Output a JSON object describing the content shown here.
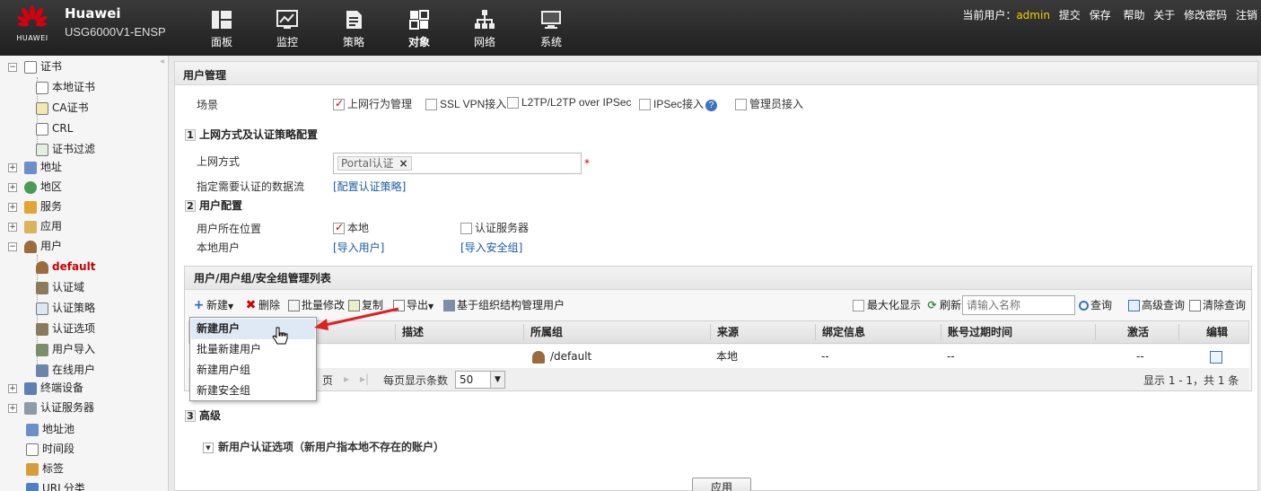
{
  "topbar": {
    "logo_text": "HUAWEI",
    "brand_name": "Huawei",
    "product": "USG6000V1-ENSP",
    "nav": [
      {
        "label": "面板",
        "icon": "dashboard-icon"
      },
      {
        "label": "监控",
        "icon": "monitor-icon"
      },
      {
        "label": "策略",
        "icon": "policy-icon"
      },
      {
        "label": "对象",
        "icon": "object-icon"
      },
      {
        "label": "网络",
        "icon": "network-icon"
      },
      {
        "label": "系统",
        "icon": "system-icon"
      }
    ],
    "current_user_label": "当前用户：",
    "current_user": "admin",
    "links": [
      "提交",
      "保存",
      "帮助",
      "关于",
      "修改密码",
      "注销"
    ]
  },
  "sidebar": {
    "collapse_glyph": "«",
    "items": [
      {
        "label": "证书",
        "level": 0,
        "expander": "−"
      },
      {
        "label": "本地证书",
        "level": 1
      },
      {
        "label": "CA证书",
        "level": 1
      },
      {
        "label": "CRL",
        "level": 1
      },
      {
        "label": "证书过滤",
        "level": 1
      },
      {
        "label": "地址",
        "level": 0,
        "expander": "+"
      },
      {
        "label": "地区",
        "level": 0,
        "expander": "+"
      },
      {
        "label": "服务",
        "level": 0,
        "expander": "+"
      },
      {
        "label": "应用",
        "level": 0,
        "expander": "+"
      },
      {
        "label": "用户",
        "level": 0,
        "expander": "−"
      },
      {
        "label": "default",
        "level": 1,
        "selected": true
      },
      {
        "label": "认证域",
        "level": 1
      },
      {
        "label": "认证策略",
        "level": 1
      },
      {
        "label": "认证选项",
        "level": 1
      },
      {
        "label": "用户导入",
        "level": 1
      },
      {
        "label": "在线用户",
        "level": 1
      },
      {
        "label": "终端设备",
        "level": 0,
        "expander": "+"
      },
      {
        "label": "认证服务器",
        "level": 0,
        "expander": "+"
      },
      {
        "label": "地址池",
        "level": 0
      },
      {
        "label": "时间段",
        "level": 0
      },
      {
        "label": "标签",
        "level": 0
      },
      {
        "label": "URL分类",
        "level": 0
      }
    ]
  },
  "main": {
    "page_title": "用户管理",
    "scene_label": "场景",
    "scenes": [
      {
        "label": "上网行为管理",
        "checked": true
      },
      {
        "label": "SSL VPN接入",
        "checked": false
      },
      {
        "label": "L2TP/L2TP over IPSec",
        "checked": false
      },
      {
        "label": "IPSec接入",
        "checked": false
      },
      {
        "label": "管理员接入",
        "checked": false
      }
    ],
    "section1": {
      "num": "1",
      "title": "上网方式及认证策略配置"
    },
    "access_mode_label": "上网方式",
    "access_mode_token": "Portal认证",
    "token_remove": "×",
    "required_mark": "*",
    "flow_label": "指定需要认证的数据流",
    "flow_link": "[配置认证策略]",
    "section2": {
      "num": "2",
      "title": "用户配置"
    },
    "location_label": "用户所在位置",
    "location_local": {
      "label": "本地",
      "checked": true
    },
    "location_server": {
      "label": "认证服务器",
      "checked": false
    },
    "local_user_label": "本地用户",
    "import_user_link": "[导入用户]",
    "import_group_link": "[导入安全组]",
    "list": {
      "title": "用户/用户组/安全组管理列表",
      "toolbar": {
        "new": "新建",
        "delete": "删除",
        "batch_edit": "批量修改",
        "copy": "复制",
        "export": "导出",
        "org_manage": "基于组织结构管理用户",
        "maximize": "最大化显示",
        "refresh": "刷新",
        "search_placeholder": "请输入名称",
        "query": "查询",
        "advanced_query": "高级查询",
        "clear_query": "清除查询"
      },
      "columns": [
        "描述",
        "所属组",
        "来源",
        "绑定信息",
        "账号过期时间",
        "激活",
        "编辑"
      ],
      "rows": [
        {
          "group": "/default",
          "source": "本地",
          "binding": "--",
          "expire": "--",
          "active": "--"
        }
      ],
      "pager": {
        "page_suffix": "页",
        "per_page_label": "每页显示条数",
        "per_page": "50",
        "summary": "显示 1 - 1，共 1 条"
      }
    },
    "new_menu": [
      "新建用户",
      "批量新建用户",
      "新建用户组",
      "新建安全组"
    ],
    "section3": {
      "num": "3",
      "title": "高级"
    },
    "advanced_option": "新用户认证选项（新用户指本地不存在的账户）",
    "apply_button": "应用"
  },
  "colors": {
    "accent_red": "#cc0000",
    "link_blue": "#1a5aa8",
    "username_yellow": "#f3d000",
    "topbar": "#2a2a2a"
  }
}
